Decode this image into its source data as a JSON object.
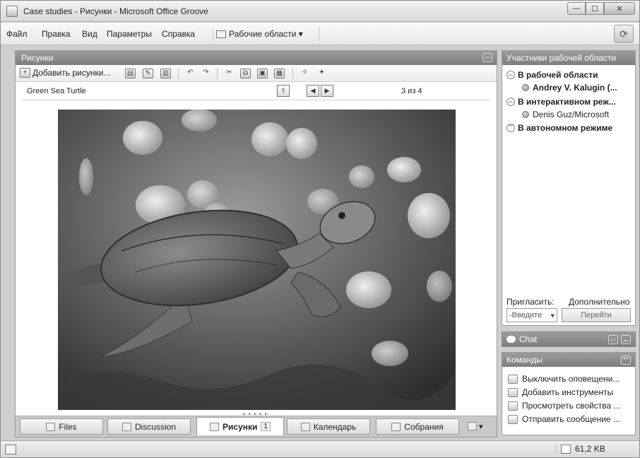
{
  "window": {
    "title": "Case studies - Рисунки - Microsoft Office Groove"
  },
  "menu": {
    "items": [
      "Файл",
      "Правка",
      "Вид",
      "Параметры",
      "Справка"
    ],
    "workspaces_label": "Рабочие области ▾"
  },
  "pictures_panel": {
    "title": "Рисунки",
    "add_pictures_label": "Добавить рисунки...",
    "current_picture": "Green Sea Turtle",
    "counter": "3 из 4"
  },
  "tabs": [
    {
      "label": "Files"
    },
    {
      "label": "Discussion"
    },
    {
      "label": "Рисунки",
      "badge": "1",
      "active": true
    },
    {
      "label": "Календарь"
    },
    {
      "label": "Собрания"
    }
  ],
  "participants": {
    "title": "Участники рабочей области",
    "groups": [
      {
        "label": "В рабочей области",
        "members": [
          {
            "name": "Andrey V. Kalugin (..."
          }
        ]
      },
      {
        "label": "В интерактивном реж...",
        "members": [
          {
            "name": "Denis Guz/Microsoft"
          }
        ]
      },
      {
        "label": "В автономном режиме",
        "members": []
      }
    ],
    "invite_label": "Пригласить:",
    "more_label": "Дополнительно",
    "invite_placeholder": "-Введите",
    "go_label": "Перейти"
  },
  "chat": {
    "title": "Chat"
  },
  "commands": {
    "title": "Команды",
    "items": [
      "Выключить оповещени...",
      "Добавить инструменты",
      "Просмотреть свойства ...",
      "Отправить сообщение ..."
    ]
  },
  "status": {
    "size": "61,2 KB"
  }
}
